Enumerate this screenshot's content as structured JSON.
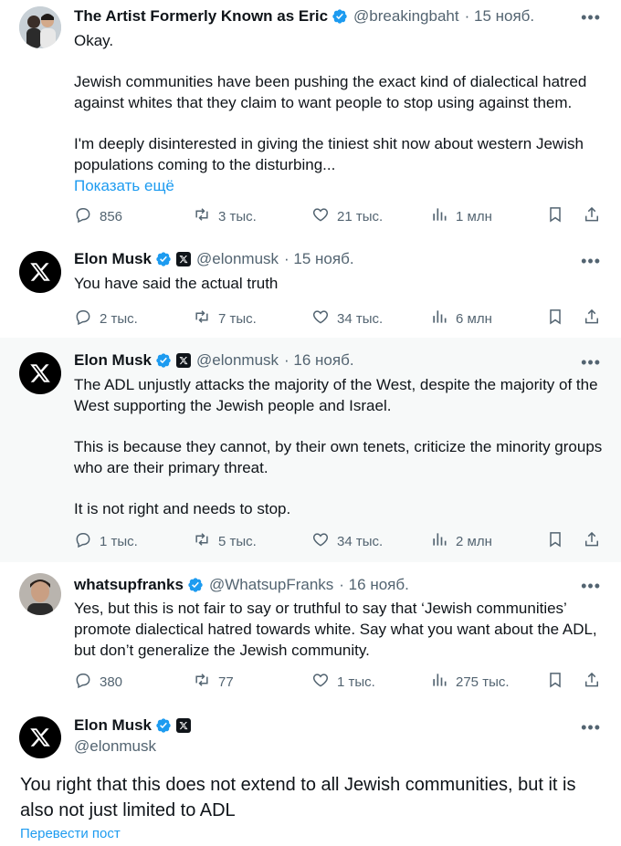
{
  "tweets": [
    {
      "name": "The Artist Formerly Known as Eric",
      "handle": "@breakingbaht",
      "date": "· 15 нояб.",
      "paragraphs": [
        "Okay.",
        "Jewish communities have been pushing the exact kind of dialectical hatred against whites that they claim to want people to stop using against them.",
        "I'm deeply disinterested in giving the tiniest shit now about western Jewish populations coming to the disturbing..."
      ],
      "show_more": "Показать ещё",
      "replies": "856",
      "reposts": "3 тыс.",
      "likes": "21 тыс.",
      "views": "1 млн"
    },
    {
      "name": "Elon Musk",
      "handle": "@elonmusk",
      "date": "· 15 нояб.",
      "paragraphs": [
        "You have said the actual truth"
      ],
      "replies": "2 тыс.",
      "reposts": "7 тыс.",
      "likes": "34 тыс.",
      "views": "6 млн"
    },
    {
      "name": "Elon Musk",
      "handle": "@elonmusk",
      "date": "· 16 нояб.",
      "paragraphs": [
        "The ADL unjustly attacks the majority of the West, despite the majority of the West supporting the Jewish people and Israel.",
        "This is because they cannot, by their own tenets, criticize the minority groups who are their primary threat.",
        "It is not right and needs to stop."
      ],
      "replies": "1 тыс.",
      "reposts": "5 тыс.",
      "likes": "34 тыс.",
      "views": "2 млн"
    },
    {
      "name": "whatsupfranks",
      "handle": "@WhatsupFranks",
      "date": "· 16 нояб.",
      "paragraphs": [
        "Yes, but this is not fair to say or truthful to say that ‘Jewish communities’ promote dialectical hatred towards white. Say what you want about the ADL, but don’t generalize the Jewish community."
      ],
      "replies": "380",
      "reposts": "77",
      "likes": "1 тыс.",
      "views": "275 тыс."
    }
  ],
  "main_tweet": {
    "name": "Elon Musk",
    "handle": "@elonmusk",
    "text": "You right that this does not extend to all Jewish communities, but it is also not just limited to ADL",
    "translate": "Перевести пост"
  },
  "icons": {
    "reply": "reply-icon",
    "repost": "repost-icon",
    "like": "like-icon",
    "views": "views-icon",
    "bookmark": "bookmark-icon",
    "share": "share-icon",
    "more": "more-icon",
    "verified": "verified-badge-icon",
    "affiliation": "x-affiliation-icon"
  },
  "colors": {
    "accent": "#1d9bf0",
    "muted": "#536471",
    "highlight_bg": "#f7f9f9"
  }
}
